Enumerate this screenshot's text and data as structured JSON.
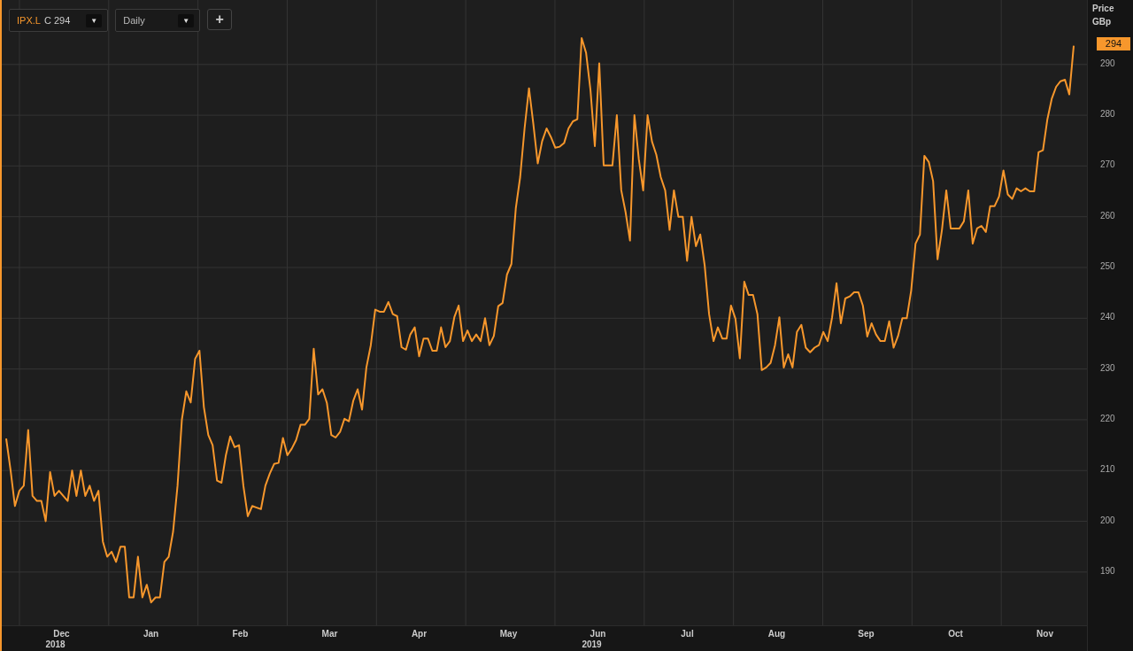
{
  "toolbar": {
    "instrument": {
      "symbol": "IPX.L",
      "quote": "C 294",
      "arrow": "▼"
    },
    "interval": {
      "value": "Daily",
      "arrow": "▼"
    },
    "add_button": "+"
  },
  "price_axis": {
    "title": "Price",
    "unit": "GBp",
    "last_price": "294"
  },
  "x_axis": {
    "months": [
      {
        "label": "Dec",
        "year": "2018"
      },
      {
        "label": "Jan"
      },
      {
        "label": "Feb"
      },
      {
        "label": "Mar"
      },
      {
        "label": "Apr"
      },
      {
        "label": "May"
      },
      {
        "label": "Jun",
        "year": "2019"
      },
      {
        "label": "Jul"
      },
      {
        "label": "Aug"
      },
      {
        "label": "Sep"
      },
      {
        "label": "Oct"
      },
      {
        "label": "Nov"
      }
    ]
  },
  "chart_data": {
    "type": "line",
    "grid": true,
    "ylim": [
      179.5,
      302.7
    ],
    "yticks": [
      {
        "value": 190,
        "label": "190"
      },
      {
        "value": 200,
        "label": "200"
      },
      {
        "value": 210,
        "label": "210"
      },
      {
        "value": 220,
        "label": "220"
      },
      {
        "value": 230,
        "label": "230"
      },
      {
        "value": 240,
        "label": "240"
      },
      {
        "value": 250,
        "label": "250"
      },
      {
        "value": 260,
        "label": "260"
      },
      {
        "value": 270,
        "label": "270"
      },
      {
        "value": 280,
        "label": "280"
      },
      {
        "value": 290,
        "label": "290"
      }
    ],
    "series": [
      {
        "color": "#f7972c",
        "values": [
          216.3,
          210,
          203,
          206,
          207,
          218,
          205,
          204,
          204,
          200,
          209.7,
          205,
          206,
          205,
          204,
          210,
          205,
          210,
          205,
          207,
          204,
          206,
          196,
          193,
          194,
          192,
          195,
          195,
          185,
          185,
          193,
          185,
          187.5,
          184,
          185,
          185,
          192,
          193,
          198,
          207,
          220,
          225.6,
          223.4,
          232,
          233.6,
          222.5,
          217,
          215,
          208,
          207.6,
          213,
          216.7,
          214.6,
          215,
          207,
          201,
          203,
          202.7,
          202.4,
          207,
          209.4,
          211.3,
          211.5,
          216.4,
          213,
          214.3,
          216,
          219,
          219,
          220.2,
          234,
          225,
          226,
          223.3,
          217,
          216.5,
          217.6,
          220.2,
          219.7,
          223.7,
          226,
          222,
          230.3,
          234.7,
          241.7,
          241.3,
          241.3,
          243.2,
          240.8,
          240.4,
          234.3,
          233.8,
          236.8,
          238.2,
          232.5,
          236,
          236,
          233.6,
          233.6,
          238.2,
          234.3,
          235.5,
          240.2,
          242.5,
          235.5,
          237.6,
          235.5,
          236.8,
          235.5,
          240,
          234.7,
          236.5,
          242.4,
          243,
          248.6,
          250.7,
          261.7,
          267.8,
          277.4,
          285.3,
          278.3,
          270.5,
          274.9,
          277.4,
          275.7,
          273.6,
          273.8,
          274.5,
          277.4,
          278.8,
          279.2,
          295.2,
          292.3,
          284.9,
          273.9,
          290.2,
          270.1,
          270.1,
          270.1,
          280,
          265.2,
          260.9,
          255.3,
          280,
          271.3,
          265.2,
          280,
          274.8,
          272.2,
          267.8,
          265.2,
          257.4,
          265.2,
          260,
          260,
          251.3,
          260,
          254.2,
          256.5,
          250.4,
          240.8,
          235.5,
          238.2,
          236,
          236,
          242.5,
          239.9,
          232.1,
          247.2,
          244.6,
          244.6,
          240.8,
          229.8,
          230.3,
          231.2,
          234.7,
          240.2,
          230.3,
          232.9,
          230.3,
          237.3,
          238.7,
          234.2,
          233.3,
          234.2,
          234.7,
          237.3,
          235.5,
          240.2,
          246.9,
          239,
          243.9,
          244.3,
          245.1,
          245.1,
          242.5,
          236.4,
          239,
          236.8,
          235.5,
          235.5,
          239.4,
          234.2,
          236.5,
          240,
          240,
          245.5,
          254.7,
          256.5,
          272,
          270.8,
          267,
          251.6,
          257.4,
          265.2,
          257.7,
          257.7,
          257.7,
          259.1,
          265.2,
          254.7,
          257.7,
          258.2,
          257,
          262.1,
          262.1,
          264,
          269.1,
          264.4,
          263.5,
          265.6,
          265,
          265.6,
          265,
          265,
          272.7,
          273.1,
          279.2,
          283.2,
          285.6,
          286.7,
          287,
          284.1,
          293.7
        ]
      }
    ]
  }
}
